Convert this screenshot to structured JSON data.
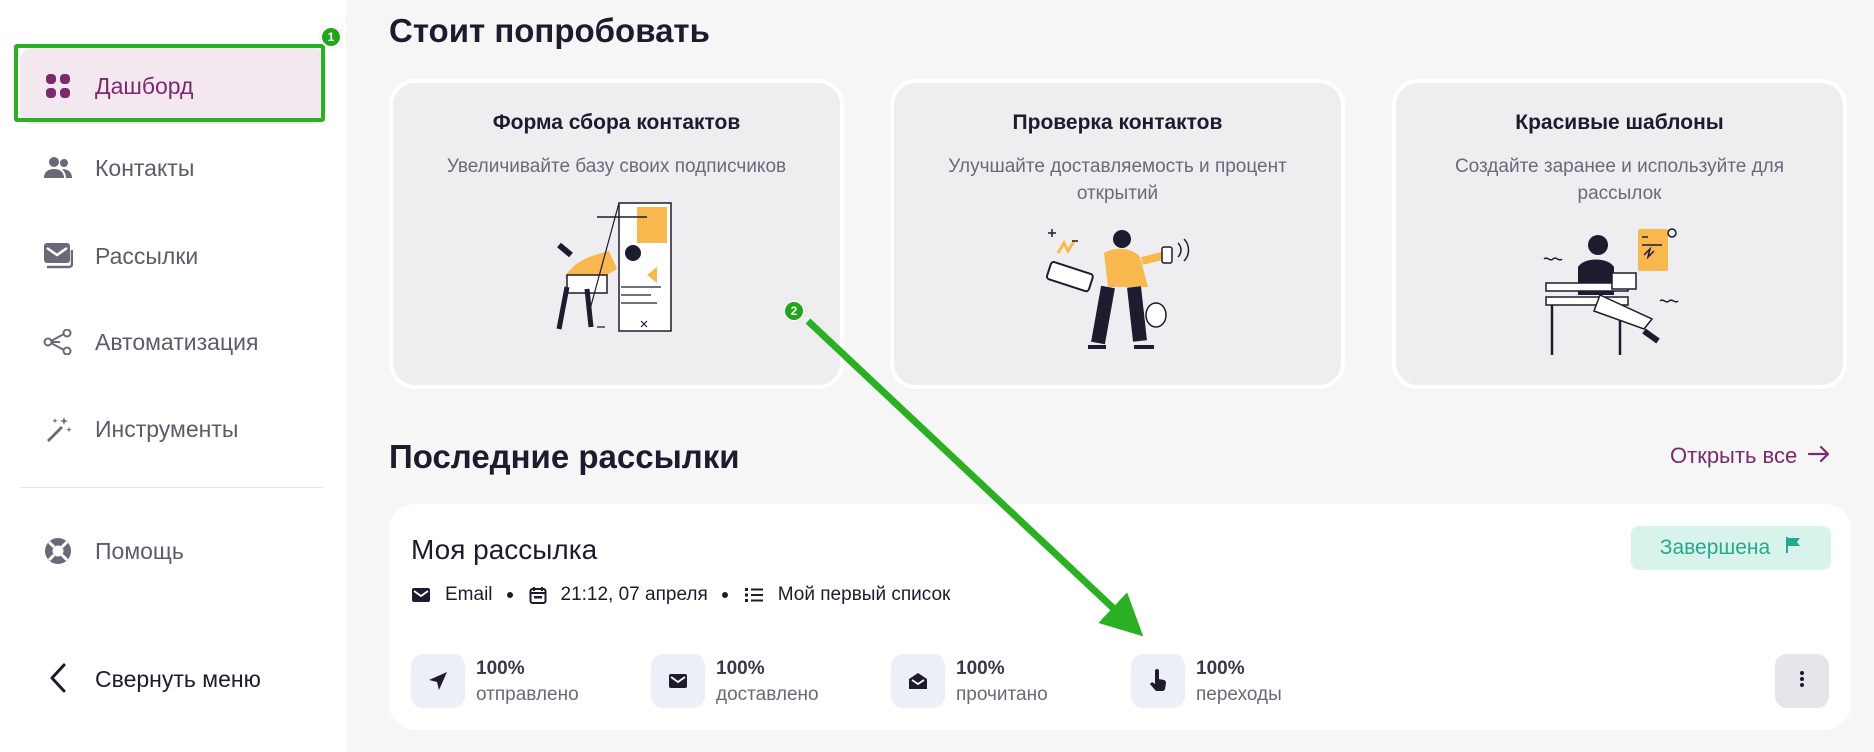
{
  "sidebar": {
    "items": [
      {
        "label": "Дашборд",
        "icon": "grid-icon"
      },
      {
        "label": "Контакты",
        "icon": "users-icon"
      },
      {
        "label": "Рассылки",
        "icon": "mail-icon"
      },
      {
        "label": "Автоматизация",
        "icon": "share-nodes-icon"
      },
      {
        "label": "Инструменты",
        "icon": "magic-wand-icon"
      },
      {
        "label": "Помощь",
        "icon": "lifebuoy-icon"
      }
    ],
    "collapse_label": "Свернуть меню"
  },
  "annotations": {
    "badge1": "1",
    "badge2": "2"
  },
  "try_section": {
    "title": "Стоит попробовать",
    "cards": [
      {
        "title": "Форма сбора контактов",
        "desc": "Увеличивайте базу своих подписчиков"
      },
      {
        "title": "Проверка контактов",
        "desc": "Улучшайте доставляемость и процент открытий"
      },
      {
        "title": "Красивые шаблоны",
        "desc": "Создайте заранее и используйте для рассылок"
      }
    ]
  },
  "recent": {
    "title": "Последние рассылки",
    "open_all": "Открыть все",
    "mailing": {
      "title": "Моя рассылка",
      "status": "Завершена",
      "channel": "Email",
      "datetime": "21:12, 07 апреля",
      "list": "Мой первый список",
      "stats": [
        {
          "value": "100%",
          "label": "отправлено"
        },
        {
          "value": "100%",
          "label": "доставлено"
        },
        {
          "value": "100%",
          "label": "прочитано"
        },
        {
          "value": "100%",
          "label": "переходы"
        }
      ]
    }
  },
  "colors": {
    "accent": "#7b2a6c",
    "highlight": "#2bb024",
    "status": "#27a88e"
  }
}
